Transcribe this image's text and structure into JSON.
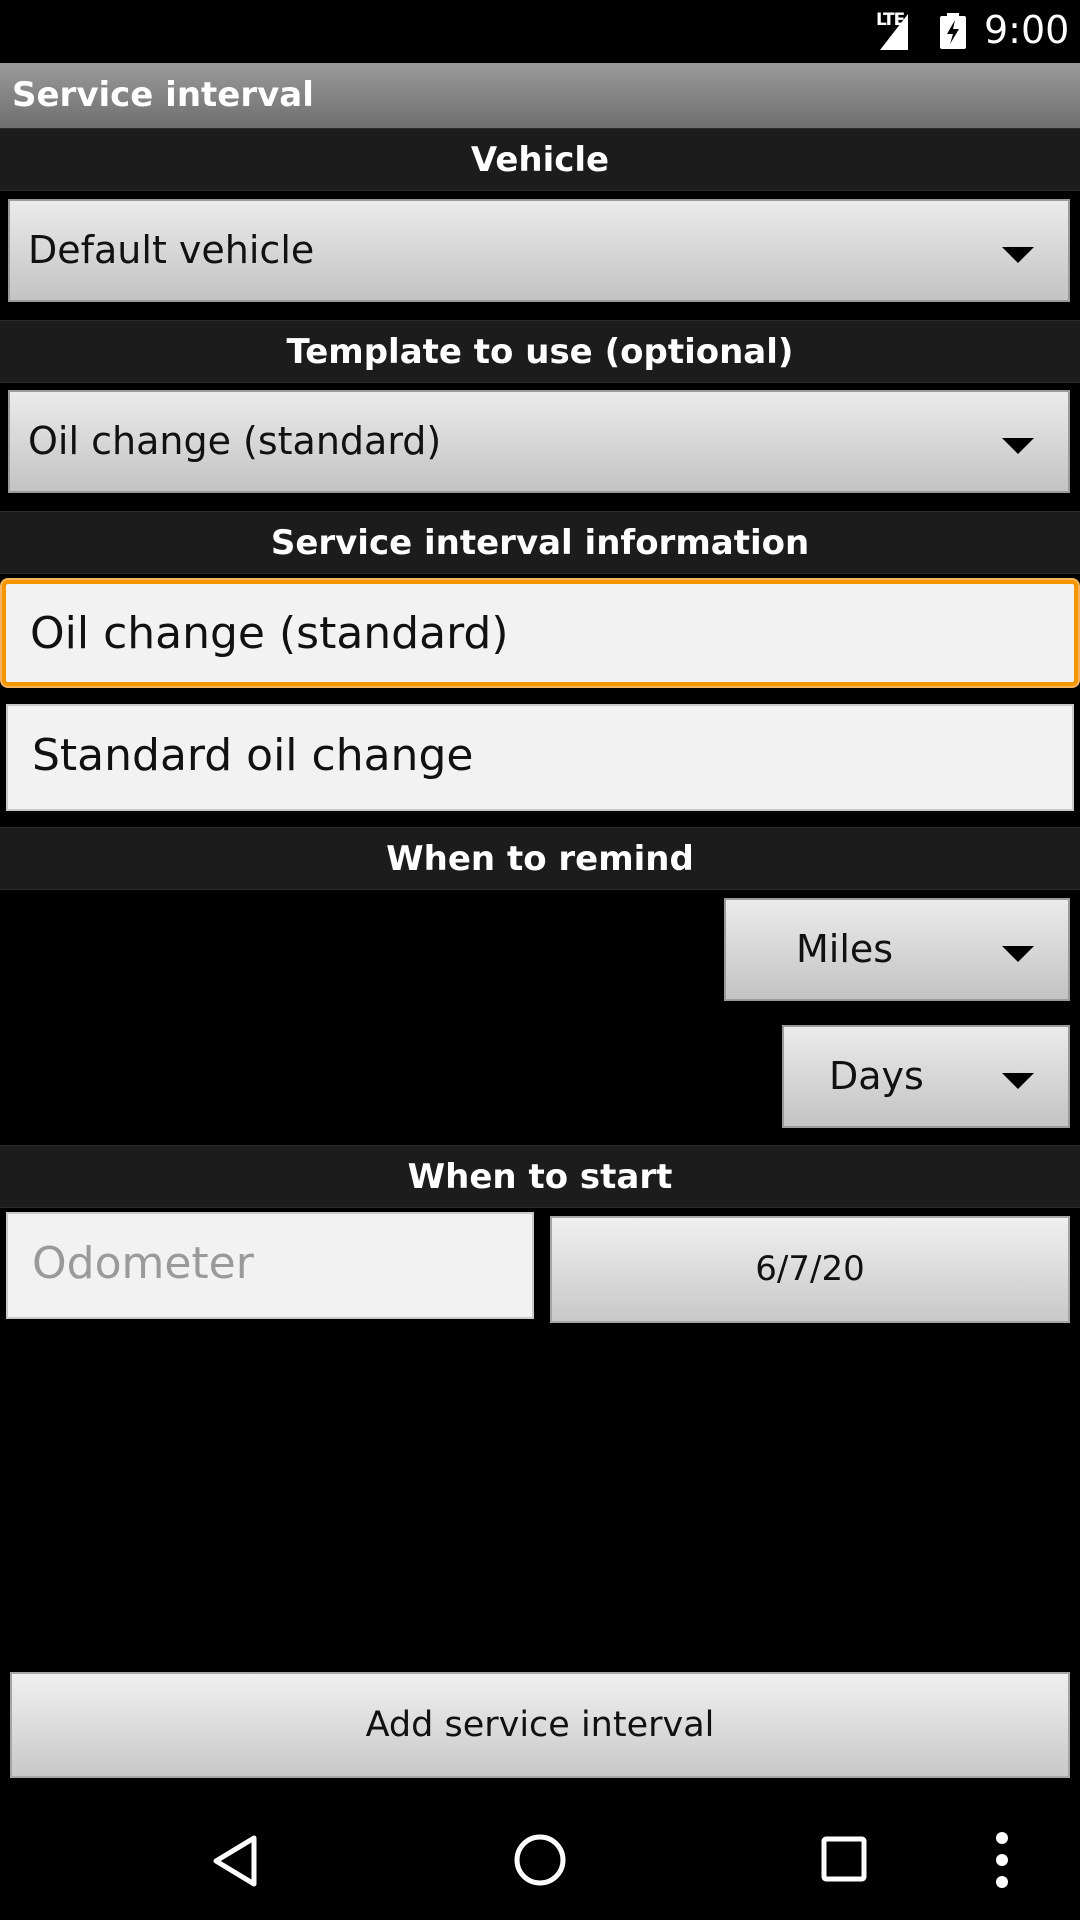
{
  "status_bar": {
    "network": "LTE",
    "time": "9:00"
  },
  "title_bar": {
    "title": "Service interval"
  },
  "sections": {
    "vehicle": "Vehicle",
    "template": "Template to use (optional)",
    "info": "Service interval information",
    "remind": "When to remind",
    "start": "When to start"
  },
  "vehicle_spinner": {
    "value": "Default vehicle"
  },
  "template_spinner": {
    "value": "Oil change (standard)"
  },
  "info": {
    "name_value": "Oil change (standard)",
    "description_value": "Standard oil change"
  },
  "remind": {
    "distance_unit": "Miles",
    "time_unit": "Days"
  },
  "start": {
    "odometer_placeholder": "Odometer",
    "date_value": "6/7/20"
  },
  "actions": {
    "add_label": "Add service interval"
  },
  "icons": {
    "back": "back-triangle-icon",
    "home": "home-circle-icon",
    "recents": "recents-square-icon",
    "overflow": "overflow-menu-icon"
  },
  "colors": {
    "focus_accent": "#f39600"
  }
}
